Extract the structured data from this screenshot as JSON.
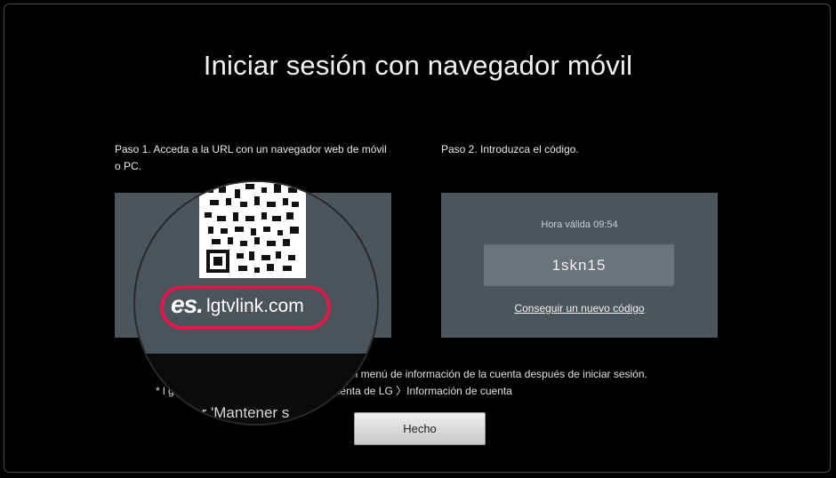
{
  "title": "Iniciar sesión con navegador móvil",
  "step1": {
    "label": "Paso 1. Acceda a la URL con un navegador web de móvil o PC."
  },
  "step2": {
    "label": "Paso 2. Introduzca el código.",
    "valid_time": "Hora válida 09:54",
    "code": "1skn15",
    "new_code_link": "Conseguir un nuevo código"
  },
  "magnifier": {
    "url_prefix": "es.",
    "url_domain": "lgtvlink.com",
    "partial_text": "* ... activar 'Mantener s"
  },
  "notes": {
    "line1": "a' en el menú de información de la cuenta después de iniciar sesión.",
    "line2": "* l                                               guración 〉General 〉Sistema 〉Cuenta de LG 〉Información de cuenta"
  },
  "buttons": {
    "done": "Hecho"
  },
  "colors": {
    "accent_ring": "#e0194a",
    "panel": "#4d555c"
  }
}
